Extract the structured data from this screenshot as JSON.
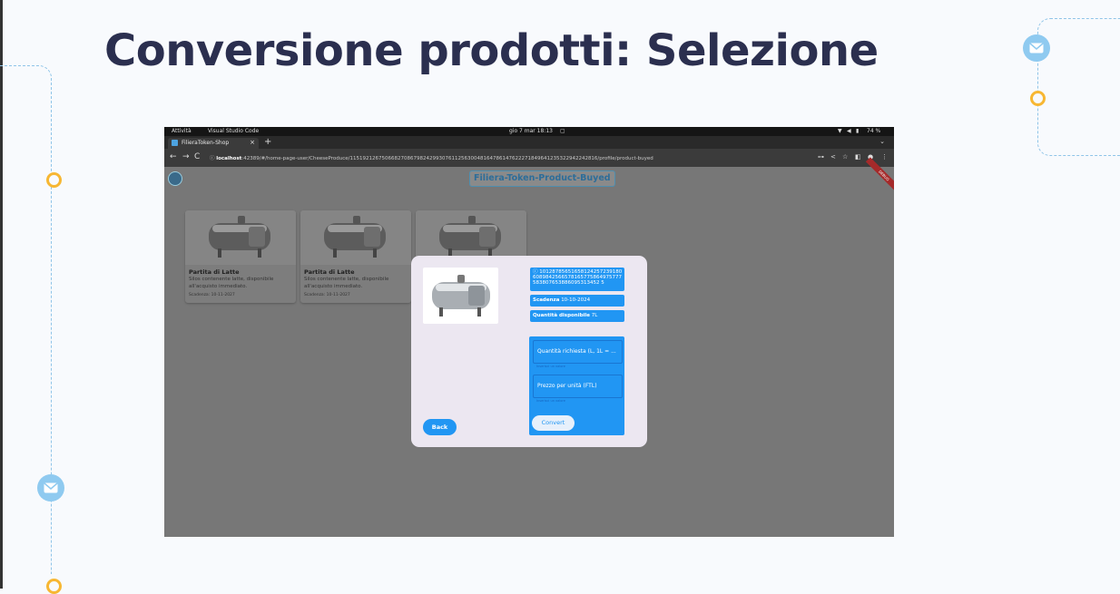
{
  "slide": {
    "title": "Conversione prodotti: Selezione",
    "colors": {
      "title": "#2b2f4f",
      "accent_ring": "#f7b733",
      "accent_bubble": "#8fcaf0",
      "line": "#8fc4e8"
    }
  },
  "screenshot": {
    "topbar": {
      "activities": "Attività",
      "app": "Visual Studio Code",
      "clock": "gio 7 mar  18:13",
      "battery": "74 %"
    },
    "browser": {
      "tab_title": "FilieraToken-Shop",
      "url_host": "localhost",
      "url_path": ":42389/#/home-page-user/CheeseProduce/115192126750668270867982429930761125630048164786147622271849641235322942242816/profile/product-buyed"
    },
    "app": {
      "title": "Filiera-Token-Product-Buyed",
      "debug_banner": "DEBUG",
      "cards": [
        {
          "title": "Partita di Latte",
          "description": "Silos contenente latte, disponibile all'acquisto immediato.",
          "expiry": "Scadenza: 10-11-2027"
        },
        {
          "title": "Partita di Latte",
          "description": "Silos contenente latte, disponibile all'acquisto immediato.",
          "expiry": "Scadenza: 10-11-2027"
        },
        {
          "title": "",
          "description": "",
          "expiry": ""
        }
      ],
      "dialog": {
        "id_text": "101287856516581242572391806089842566578165775864975777583807653886095313452 5",
        "expiry_label": "Scadenza",
        "expiry_value": "10-10-2024",
        "qty_label": "Quantità disponibile",
        "qty_value": "7L",
        "field_qty_placeholder": "Quantità richiesta  (L, 1L = ...",
        "field_qty_help": "Inserisci un valore",
        "field_price_placeholder": "Prezzo per unità (FTL)",
        "field_price_help": "Inserisci un valore",
        "convert_label": "Convert",
        "back_label": "Back"
      }
    }
  }
}
